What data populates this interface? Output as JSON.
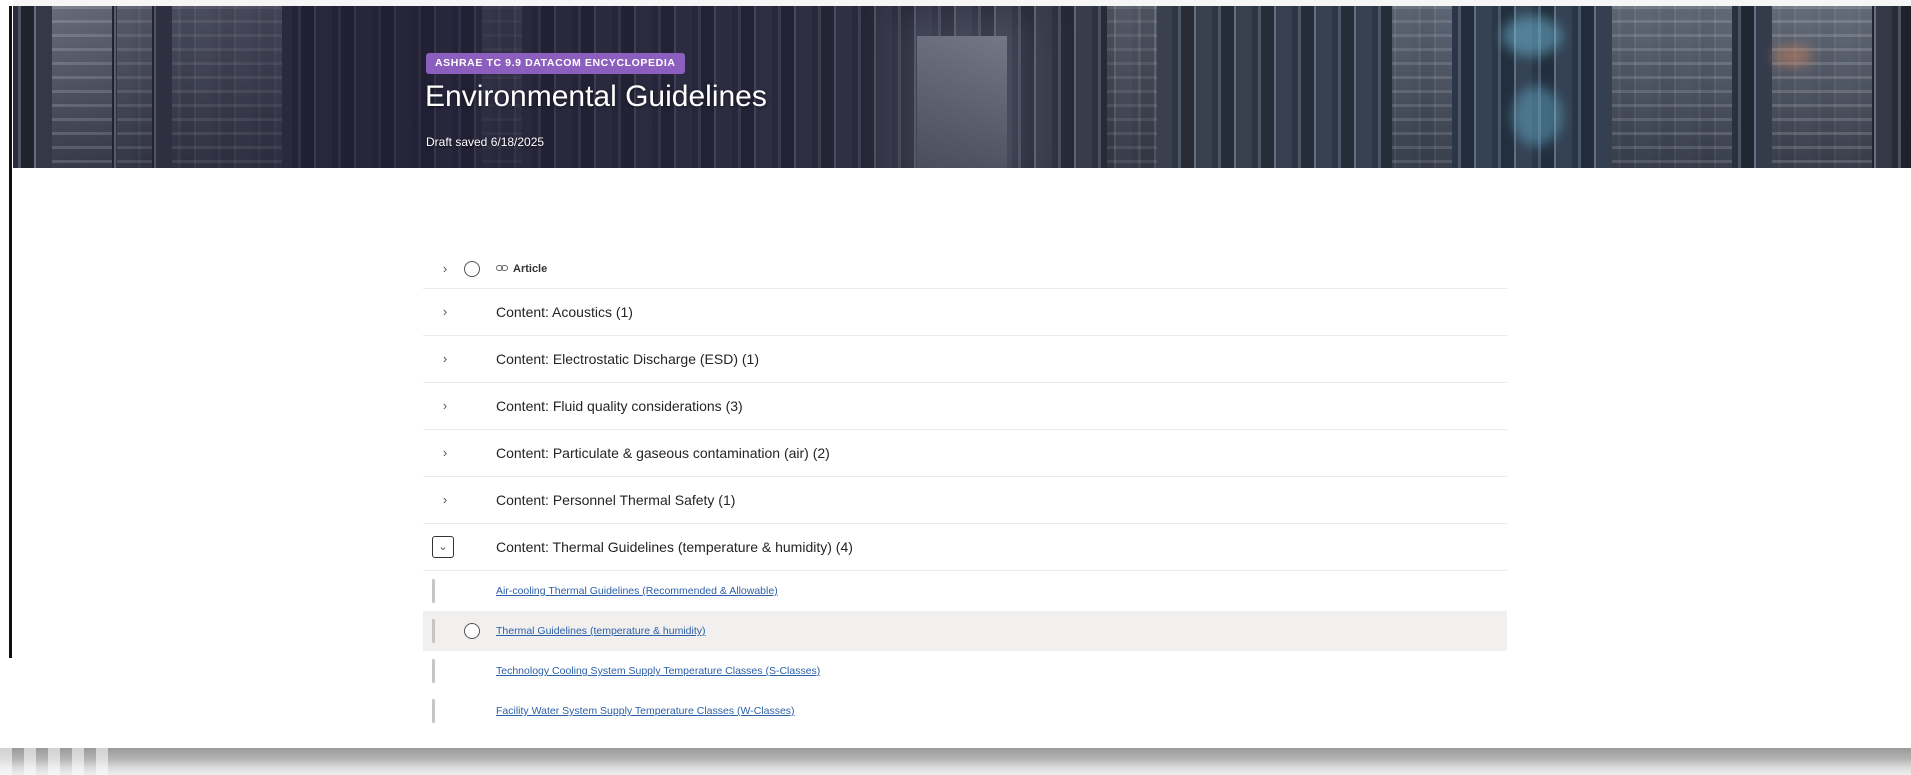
{
  "hero": {
    "badge": "ASHRAE TC 9.9 DATACOM ENCYCLOPEDIA",
    "title": "Environmental Guidelines",
    "status": "Draft saved 6/18/2025",
    "badge_color": "#8c5fbe"
  },
  "list": {
    "header": {
      "label": "Article",
      "icon": "link-icon"
    },
    "groups": [
      {
        "label": "Content: Acoustics (1)",
        "expanded": false
      },
      {
        "label": "Content: Electrostatic Discharge (ESD) (1)",
        "expanded": false
      },
      {
        "label": "Content: Fluid quality considerations (3)",
        "expanded": false
      },
      {
        "label": "Content: Particulate & gaseous contamination (air) (2)",
        "expanded": false
      },
      {
        "label": "Content: Personnel Thermal Safety (1)",
        "expanded": false
      },
      {
        "label": "Content: Thermal Guidelines (temperature & humidity) (4)",
        "expanded": true
      }
    ],
    "items": [
      {
        "label": "Air-cooling Thermal Guidelines (Recommended & Allowable)",
        "selected": false
      },
      {
        "label": "Thermal Guidelines (temperature & humidity)",
        "selected": true
      },
      {
        "label": "Technology Cooling System Supply Temperature Classes (S-Classes)",
        "selected": false
      },
      {
        "label": "Facility Water System Supply Temperature Classes (W-Classes)",
        "selected": false
      }
    ],
    "link_color": "#2b5fa6",
    "selected_row_color": "#f1f0ef"
  }
}
